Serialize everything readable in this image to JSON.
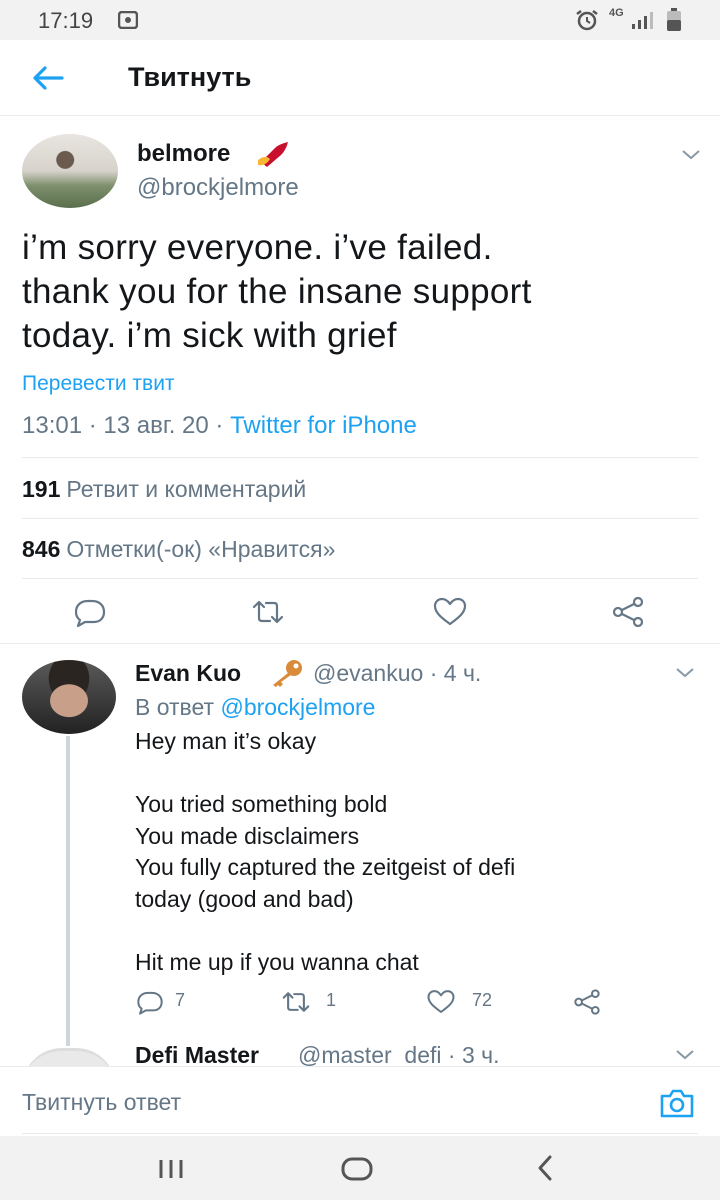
{
  "status_bar": {
    "time": "17:19",
    "network": "4G"
  },
  "header": {
    "title": "Твитнуть"
  },
  "tweet": {
    "author_name": "belmore",
    "author_handle": "@brockjelmore",
    "text": "i’m sorry everyone. i’ve failed.\nthank you for the insane support\ntoday. i’m sick with grief",
    "translate_label": "Перевести твит",
    "time": "13:01",
    "date": "13 авг. 20",
    "source": "Twitter for iPhone",
    "retweets_count": "191",
    "retweets_label": "Ретвит и комментарий",
    "likes_count": "846",
    "likes_label": "Отметки(-ок) «Нравится»"
  },
  "reply": {
    "author_name": "Evan Kuo",
    "author_handle": "@evankuo",
    "age": "4 ч.",
    "reply_to_label": "В ответ",
    "reply_to_mention": "@brockjelmore",
    "lines": [
      "Hey man it’s okay",
      "",
      "You tried something bold",
      "You made disclaimers",
      "You fully captured the zeitgeist of defi",
      "today (good and bad)",
      "",
      "Hit me up if you wanna chat"
    ],
    "reply_count": "7",
    "retweet_count": "1",
    "like_count": "72"
  },
  "next_reply": {
    "author_name": "Defi Master",
    "author_handle": "@master_defi",
    "age": "3 ч."
  },
  "composer": {
    "placeholder": "Твитнуть ответ"
  },
  "colors": {
    "accent": "#1da1f2",
    "secondary_text": "#657786",
    "divider": "#e6ecf0"
  }
}
